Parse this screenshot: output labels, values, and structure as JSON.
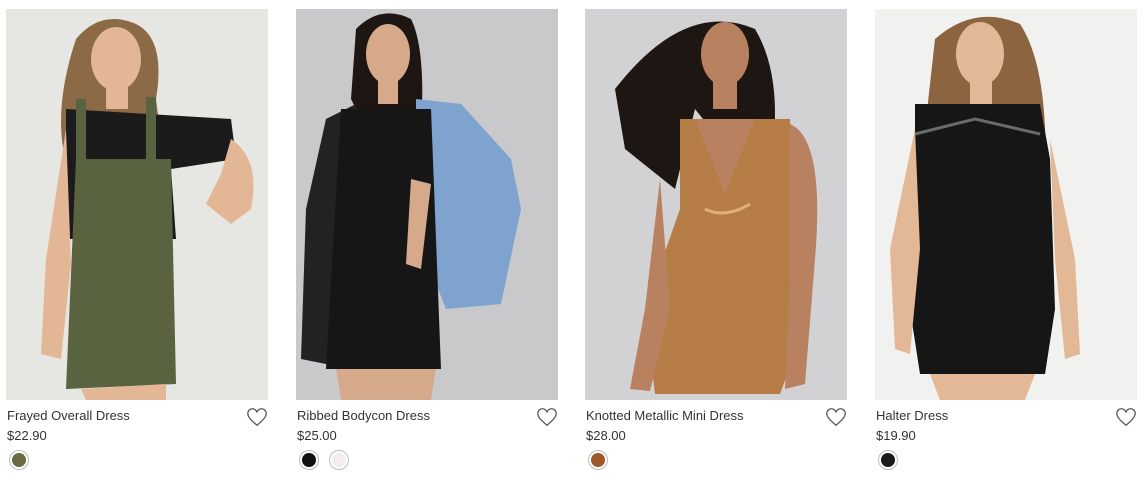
{
  "products": [
    {
      "name": "Frayed Overall Dress",
      "price": "$22.90",
      "image": {
        "background": "#ebebe9",
        "garment": "#5a6340",
        "top": "#1b1b1b",
        "hair": "#8b6a45",
        "skin": "#e3b796"
      },
      "swatches": [
        {
          "color": "#6b6a45",
          "label": "olive"
        }
      ]
    },
    {
      "name": "Ribbed Bodycon Dress",
      "price": "$25.00",
      "image": {
        "background": "#c9c9cc",
        "garment": "#161616",
        "jacket": "#7ea3cf",
        "jacket2": "#222222",
        "hair": "#1e1612",
        "skin": "#d6a98a"
      },
      "swatches": [
        {
          "color": "#111111",
          "label": "black"
        },
        {
          "color": "#f3edef",
          "label": "white"
        }
      ]
    },
    {
      "name": "Knotted Metallic Mini Dress",
      "price": "$28.00",
      "image": {
        "background": "#d2d1d4",
        "garment": "#b67c45",
        "hair": "#1d1612",
        "skin": "#b88261"
      },
      "swatches": [
        {
          "color": "#a0582b",
          "label": "bronze"
        }
      ]
    },
    {
      "name": "Halter Dress",
      "price": "$19.90",
      "image": {
        "background": "#f1f1ef",
        "garment": "#161616",
        "hair": "#8c6440",
        "skin": "#e2b896"
      },
      "swatches": [
        {
          "color": "#1a1a1a",
          "label": "black"
        }
      ]
    }
  ]
}
